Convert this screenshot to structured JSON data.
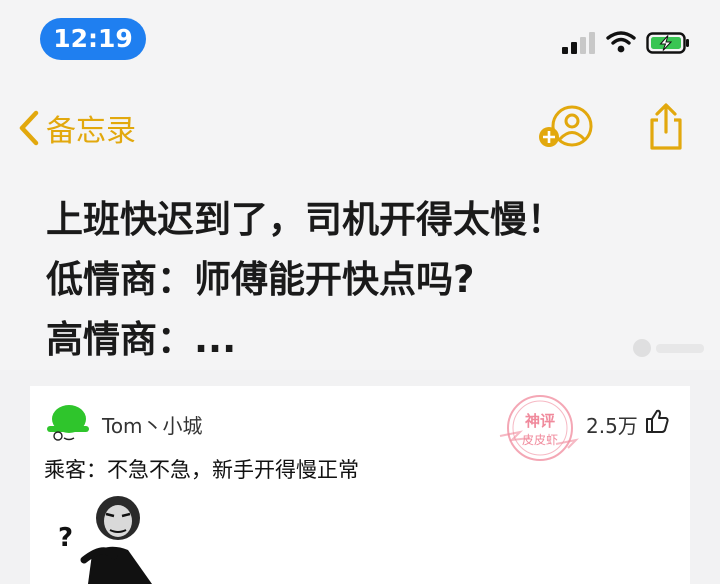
{
  "status_bar": {
    "time": "12:19",
    "signal_icon": "cellular-signal-icon",
    "wifi_icon": "wifi-icon",
    "battery_icon": "battery-charging-icon",
    "time_pill_color": "#1f7ff0"
  },
  "nav": {
    "back_label": "备忘录",
    "back_icon": "chevron-left-icon",
    "collaborate_icon": "add-person-icon",
    "share_icon": "share-icon",
    "accent_color": "#e2a80d"
  },
  "note": {
    "lines": [
      "上班快迟到了，司机开得太慢！",
      "低情商：师傅能开快点吗?",
      "高情商：..."
    ]
  },
  "comment": {
    "username": "Tom丶小城",
    "likes": "2.5万",
    "text": "乘客：不急不急，新手开得慢正常",
    "stamp_text": [
      "神评",
      "皮皮虾"
    ],
    "stamp_color": "#f08a9c",
    "avatar_icon": "green-helmet-avatar",
    "like_icon": "thumbs-up-icon",
    "meme_text": "?"
  }
}
